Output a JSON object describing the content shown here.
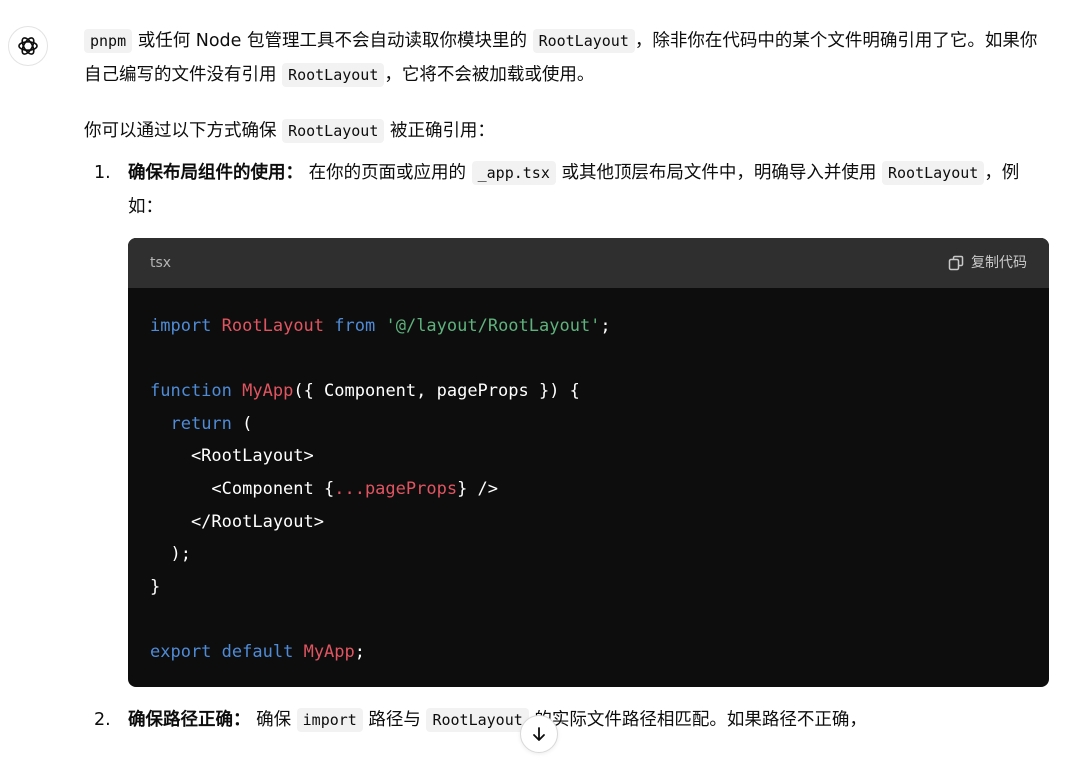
{
  "message": {
    "intro_p1": [
      {
        "t": "code",
        "v": "pnpm"
      },
      {
        "t": "text",
        "v": " 或任何 Node 包管理工具不会自动读取你模块里的 "
      },
      {
        "t": "code",
        "v": "RootLayout"
      },
      {
        "t": "text",
        "v": "，除非你在代码中的某个文件明确引用了它。如果你自己编写的文件没有引用 "
      },
      {
        "t": "code",
        "v": "RootLayout"
      },
      {
        "t": "text",
        "v": "，它将不会被加载或使用。"
      }
    ],
    "intro_p2": [
      {
        "t": "text",
        "v": "你可以通过以下方式确保 "
      },
      {
        "t": "code",
        "v": "RootLayout"
      },
      {
        "t": "text",
        "v": " 被正确引用："
      }
    ],
    "steps": [
      {
        "number": "1.",
        "parts": [
          {
            "t": "bold",
            "v": "确保布局组件的使用："
          },
          {
            "t": "text",
            "v": " 在你的页面或应用的 "
          },
          {
            "t": "code",
            "v": "_app.tsx"
          },
          {
            "t": "text",
            "v": " 或其他顶层布局文件中，明确导入并使用 "
          },
          {
            "t": "code",
            "v": "RootLayout"
          },
          {
            "t": "text",
            "v": "，例如："
          }
        ]
      },
      {
        "number": "2.",
        "parts": [
          {
            "t": "bold",
            "v": "确保路径正确："
          },
          {
            "t": "text",
            "v": " 确保 "
          },
          {
            "t": "code",
            "v": "import"
          },
          {
            "t": "text",
            "v": " 路径与 "
          },
          {
            "t": "code",
            "v": "RootLayout"
          },
          {
            "t": "text",
            "v": " 的实际文件路径相匹配。如果路径不正确，"
          }
        ]
      }
    ]
  },
  "code_block": {
    "language": "tsx",
    "copy_label": "复制代码",
    "lines": [
      [
        {
          "c": "k",
          "v": "import"
        },
        {
          "c": "p",
          "v": " "
        },
        {
          "c": "n",
          "v": "RootLayout"
        },
        {
          "c": "p",
          "v": " "
        },
        {
          "c": "k",
          "v": "from"
        },
        {
          "c": "p",
          "v": " "
        },
        {
          "c": "s",
          "v": "'@/layout/RootLayout'"
        },
        {
          "c": "p",
          "v": ";"
        }
      ],
      [],
      [
        {
          "c": "k",
          "v": "function"
        },
        {
          "c": "p",
          "v": " "
        },
        {
          "c": "n",
          "v": "MyApp"
        },
        {
          "c": "p",
          "v": "({ Component, pageProps }) {"
        }
      ],
      [
        {
          "c": "p",
          "v": "  "
        },
        {
          "c": "k",
          "v": "return"
        },
        {
          "c": "p",
          "v": " ("
        }
      ],
      [
        {
          "c": "p",
          "v": "    <RootLayout>"
        }
      ],
      [
        {
          "c": "p",
          "v": "      <Component {"
        },
        {
          "c": "n",
          "v": "...pageProps"
        },
        {
          "c": "p",
          "v": "} />"
        }
      ],
      [
        {
          "c": "p",
          "v": "    </RootLayout>"
        }
      ],
      [
        {
          "c": "p",
          "v": "  );"
        }
      ],
      [
        {
          "c": "p",
          "v": "}"
        }
      ],
      [],
      [
        {
          "c": "k",
          "v": "export"
        },
        {
          "c": "p",
          "v": " "
        },
        {
          "c": "k",
          "v": "default"
        },
        {
          "c": "p",
          "v": " "
        },
        {
          "c": "n",
          "v": "MyApp"
        },
        {
          "c": "p",
          "v": ";"
        }
      ]
    ]
  },
  "icons": {
    "assistant_avatar": "openai-logo-icon",
    "copy": "copy-icon",
    "scroll_down": "arrow-down-icon"
  },
  "colors": {
    "code_bg": "#0d0d0d",
    "code_header_bg": "#2f2f2f",
    "keyword": "#4f8bd6",
    "identifier": "#e05561",
    "string": "#5fb27d"
  }
}
